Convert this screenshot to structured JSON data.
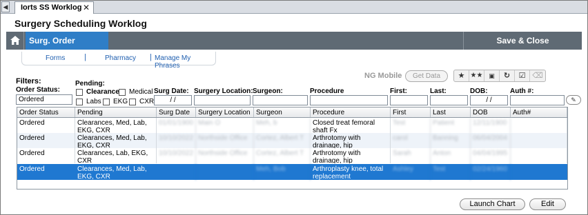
{
  "tab": {
    "label": "Iorts SS Worklog",
    "close": "✕",
    "arrow": "◀"
  },
  "page_title": "Surgery Scheduling Worklog",
  "navbar": {
    "active_label": "Surg. Order Worklog",
    "save_close_label": "Save & Close"
  },
  "sublinks": {
    "forms": "Forms",
    "pharmacy": "Pharmacy",
    "phrases": "Manage My Phrases",
    "separator": "|"
  },
  "filters": {
    "title": "Filters:",
    "order_status_label": "Order Status:",
    "order_status_value": "Ordered",
    "pending_label": "Pending:",
    "checkboxes": {
      "clearance": "Clearance",
      "medical": "Medical",
      "labs": "Labs",
      "ekg": "EKG",
      "cxr": "CXR"
    },
    "surg_date_label": "Surg Date:",
    "surg_date_value": "/ /",
    "surgery_location_label": "Surgery Location:",
    "surgeon_label": "Surgeon:",
    "procedure_label": "Procedure",
    "first_label": "First:",
    "last_label": "Last:",
    "dob_label": "DOB:",
    "dob_value": "/ /",
    "auth_label": "Auth #:"
  },
  "ng_mobile": {
    "label": "NG Mobile",
    "get_data": "Get Data"
  },
  "grid": {
    "columns": [
      "Order Status",
      "Pending",
      "Surg Date",
      "Surgery Location",
      "Surgeon",
      "Procedure",
      "First",
      "Last",
      "DOB",
      "Auth#"
    ],
    "rows": [
      [
        "Ordered",
        "Clearances, Med, Lab, EKG, CXR",
        "01/01/1900",
        "Main O",
        "Meh, b",
        "Closed treat femoral shaft Fx",
        "Test",
        "Patient",
        "12/11/1900",
        ""
      ],
      [
        "Ordered",
        "Clearances, Med, Lab, EKG, CXR",
        "10/10/2022",
        "Northside Office",
        "Cortez, Albert T",
        "Arthrotomy with drainage, hip",
        "carol",
        "Banning",
        "06/04/2004",
        ""
      ],
      [
        "Ordered",
        "Clearances, Lab, EKG, CXR",
        "10/10/2022",
        "Northside Office",
        "Cortez, Albert T",
        "Arthrotomy with drainage, hip",
        "Sarah",
        "Anton",
        "04/04/1995",
        ""
      ],
      [
        "Ordered",
        "Clearances, Med, Lab, EKG, CXR",
        "",
        "",
        "Meh, Bob",
        "Arthroplasty knee, total replacement",
        "Ashley",
        "Test",
        "02/24/1960",
        ""
      ]
    ],
    "selected_row": 3
  },
  "buttons": {
    "launch_chart": "Launch Chart",
    "edit": "Edit"
  }
}
